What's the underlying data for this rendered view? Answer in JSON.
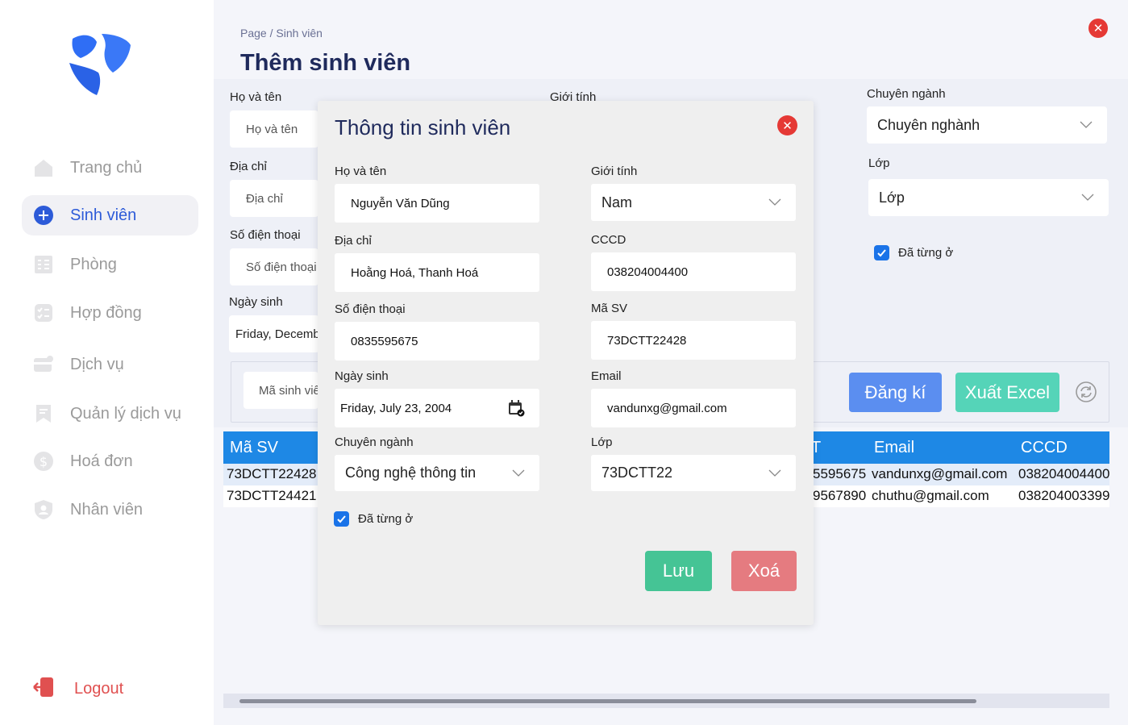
{
  "sidebar": {
    "items": [
      {
        "label": "Trang chủ",
        "icon": "home-icon"
      },
      {
        "label": "Sinh viên",
        "icon": "plus-circle-icon"
      },
      {
        "label": "Phòng",
        "icon": "grid-icon"
      },
      {
        "label": "Hợp đồng",
        "icon": "checklist-icon"
      },
      {
        "label": "Dịch vụ",
        "icon": "card-icon"
      },
      {
        "label": "Quản lý dịch vụ",
        "icon": "bookmark-icon"
      },
      {
        "label": "Hoá đơn",
        "icon": "dollar-icon"
      },
      {
        "label": "Nhân viên",
        "icon": "user-shield-icon"
      }
    ],
    "logout": "Logout"
  },
  "header": {
    "breadcrumb": "Page / Sinh viên",
    "title": "Thêm sinh viên"
  },
  "form": {
    "ho_ten_label": "Họ và tên",
    "ho_ten_placeholder": "Họ và tên",
    "gioi_tinh_label": "Giới tính",
    "chuyen_nganh_label": "Chuyên ngành",
    "chuyen_nganh_value": "Chuyên nghành",
    "dia_chi_label": "Địa chỉ",
    "dia_chi_placeholder": "Địa chỉ",
    "lop_label": "Lớp",
    "lop_value": "Lớp",
    "sdt_label": "Số điện thoại",
    "sdt_placeholder": "Số điện thoại",
    "da_tung_o": "Đã từng ở",
    "ngay_sinh_label": "Ngày sinh",
    "ngay_sinh_value": "Friday, Decemb",
    "search_placeholder": "Mã sinh viê",
    "register_btn": "Đăng kí",
    "export_btn": "Xuất Excel"
  },
  "table": {
    "headers": {
      "ma_sv": "Mã SV",
      "sdt": "T",
      "email": "Email",
      "cccd": "CCCD"
    },
    "rows": [
      {
        "ma_sv": "73DCTT22428",
        "sdt": "5595675",
        "email": "vandunxg@gmail.com",
        "cccd": "038204004400"
      },
      {
        "ma_sv": "73DCTT24421",
        "sdt": "9567890",
        "email": "chuthu@gmail.com",
        "cccd": "038204003399"
      }
    ]
  },
  "modal": {
    "title": "Thông tin sinh viên",
    "ho_ten_label": "Họ và tên",
    "ho_ten": "Nguyễn Văn Dũng",
    "gioi_tinh_label": "Giới tính",
    "gioi_tinh": "Nam",
    "dia_chi_label": "Địa chỉ",
    "dia_chi": "Hoằng Hoá, Thanh Hoá",
    "cccd_label": "CCCD",
    "cccd": "038204004400",
    "sdt_label": "Số điện thoại",
    "sdt": "0835595675",
    "ma_sv_label": "Mã SV",
    "ma_sv": "73DCTT22428",
    "ngay_sinh_label": "Ngày sinh",
    "ngay_sinh": "Friday, July 23, 2004",
    "email_label": "Email",
    "email": "vandunxg@gmail.com",
    "chuyen_nganh_label": "Chuyên ngành",
    "chuyen_nganh": "Công nghệ thông tin",
    "lop_label": "Lớp",
    "lop": "73DCTT22",
    "da_tung_o": "Đã từng ở",
    "save_btn": "Lưu",
    "delete_btn": "Xoá"
  },
  "colors": {
    "accent": "#2d5bd8",
    "save": "#45c495",
    "delete": "#e57b80",
    "register": "#5b8ef0",
    "export": "#55d4b8",
    "table_header": "#1e88e5"
  }
}
